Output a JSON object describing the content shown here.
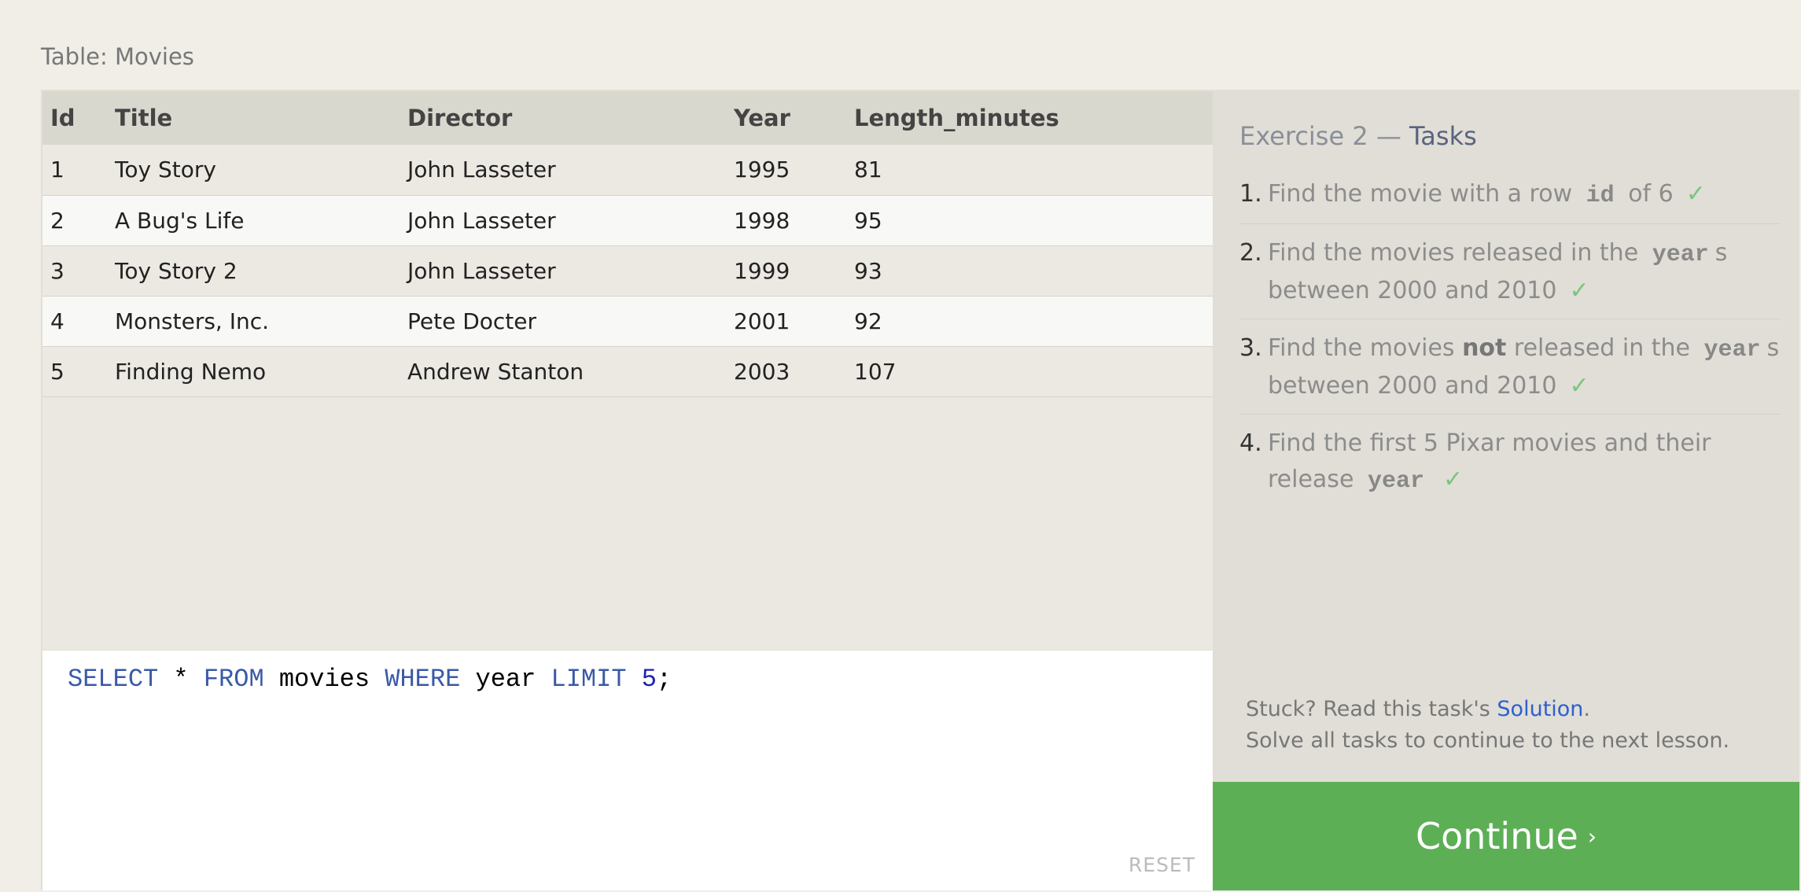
{
  "table": {
    "caption": "Table: Movies",
    "columns": [
      "Id",
      "Title",
      "Director",
      "Year",
      "Length_minutes"
    ],
    "rows": [
      [
        "1",
        "Toy Story",
        "John Lasseter",
        "1995",
        "81"
      ],
      [
        "2",
        "A Bug's Life",
        "John Lasseter",
        "1998",
        "95"
      ],
      [
        "3",
        "Toy Story 2",
        "John Lasseter",
        "1999",
        "93"
      ],
      [
        "4",
        "Monsters, Inc.",
        "Pete Docter",
        "2001",
        "92"
      ],
      [
        "5",
        "Finding Nemo",
        "Andrew Stanton",
        "2003",
        "107"
      ]
    ]
  },
  "editor": {
    "tokens": [
      {
        "t": "SELECT",
        "k": "kw"
      },
      {
        "t": " * ",
        "k": ""
      },
      {
        "t": "FROM",
        "k": "kw"
      },
      {
        "t": " movies ",
        "k": ""
      },
      {
        "t": "WHERE",
        "k": "kw"
      },
      {
        "t": " year ",
        "k": ""
      },
      {
        "t": "LIMIT",
        "k": "kw"
      },
      {
        "t": " ",
        "k": ""
      },
      {
        "t": "5",
        "k": "num"
      },
      {
        "t": ";",
        "k": ""
      }
    ],
    "reset_label": "RESET"
  },
  "tasks": {
    "title_prefix": "Exercise 2 — ",
    "title_main": "Tasks",
    "check": "✓",
    "items": [
      {
        "num": "1.",
        "parts": [
          {
            "t": "Find the movie with a row ",
            "k": ""
          },
          {
            "t": "id",
            "k": "mono"
          },
          {
            "t": " of 6",
            "k": ""
          }
        ]
      },
      {
        "num": "2.",
        "parts": [
          {
            "t": "Find the movies released in the ",
            "k": ""
          },
          {
            "t": "year",
            "k": "mono"
          },
          {
            "t": "s between 2000 and 2010",
            "k": ""
          }
        ]
      },
      {
        "num": "3.",
        "parts": [
          {
            "t": "Find the movies ",
            "k": ""
          },
          {
            "t": "not",
            "k": "strong"
          },
          {
            "t": " released in the ",
            "k": ""
          },
          {
            "t": "year",
            "k": "mono"
          },
          {
            "t": "s between 2000 and 2010",
            "k": ""
          }
        ]
      },
      {
        "num": "4.",
        "parts": [
          {
            "t": "Find the first 5 Pixar movies and their release ",
            "k": ""
          },
          {
            "t": "year",
            "k": "mono"
          }
        ]
      }
    ],
    "help_prefix": "Stuck? Read this task's ",
    "help_link": "Solution",
    "help_suffix": ".",
    "help_line2": "Solve all tasks to continue to the next lesson."
  },
  "continue": {
    "label": "Continue",
    "chevron": "›"
  },
  "colors": {
    "accent_green": "#5daf55",
    "keyword_blue": "#3a5aa8",
    "link_blue": "#2f5fcf",
    "check_green": "#7cc47f"
  }
}
